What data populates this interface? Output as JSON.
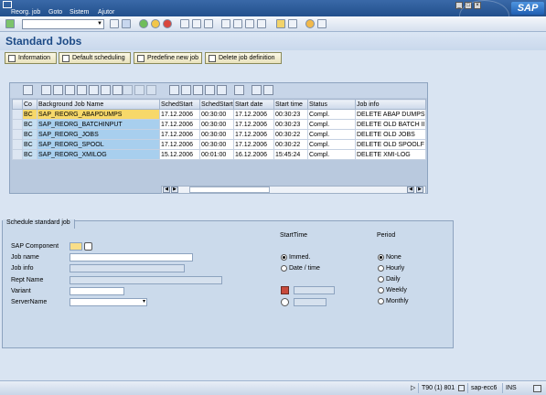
{
  "menu": [
    "Reorg. job",
    "Goto",
    "Sistem",
    "Ajutor"
  ],
  "logo_text": "SAP",
  "page_title": "Standard Jobs",
  "app_buttons": [
    {
      "label": "Information"
    },
    {
      "label": "Default scheduling"
    },
    {
      "label": "Predefine new job"
    },
    {
      "label": "Delete job definition"
    }
  ],
  "table": {
    "columns": [
      "Co",
      "Background Job Name",
      "SchedStart",
      "SchedStart",
      "Start date",
      "Start time",
      "Status",
      "Job info"
    ],
    "rows": [
      [
        "BC",
        "SAP_REORG_ABAPDUMPS",
        "17.12.2006",
        "00:30:00",
        "17.12.2006",
        "00:30:23",
        "Compl.",
        "DELETE ABAP DUMPS"
      ],
      [
        "BC",
        "SAP_REORG_BATCHINPUT",
        "17.12.2006",
        "00:30:00",
        "17.12.2006",
        "00:30:23",
        "Compl.",
        "DELETE OLD BATCH II"
      ],
      [
        "BC",
        "SAP_REORG_JOBS",
        "17.12.2006",
        "00:30:00",
        "17.12.2006",
        "00:30:22",
        "Compl.",
        "DELETE OLD JOBS"
      ],
      [
        "BC",
        "SAP_REORG_SPOOL",
        "17.12.2006",
        "00:30:00",
        "17.12.2006",
        "00:30:22",
        "Compl.",
        "DELETE OLD SPOOLF"
      ],
      [
        "BC",
        "SAP_REORG_XMILOG",
        "15.12.2006",
        "00:01:00",
        "16.12.2006",
        "15:45:24",
        "Compl.",
        "DELETE XMI-LOG"
      ]
    ]
  },
  "schedule": {
    "caption": "Schedule standard job",
    "labels": {
      "sap_component": "SAP Component",
      "job_name": "Job name",
      "job_info": "Job info",
      "rept_name": "Rept Name",
      "variant": "Variant",
      "server_name": "ServerName"
    },
    "start_time": {
      "header": "StartTime",
      "options": [
        "Immed.",
        "Date / time"
      ],
      "selected": "Immed."
    },
    "period": {
      "header": "Period",
      "options": [
        "None",
        "Hourly",
        "Daily",
        "Weekly",
        "Monthly"
      ],
      "selected": "None"
    }
  },
  "status_bar": {
    "system": "T90 (1) 801",
    "server": "sap-ecc6",
    "mode": "INS"
  }
}
